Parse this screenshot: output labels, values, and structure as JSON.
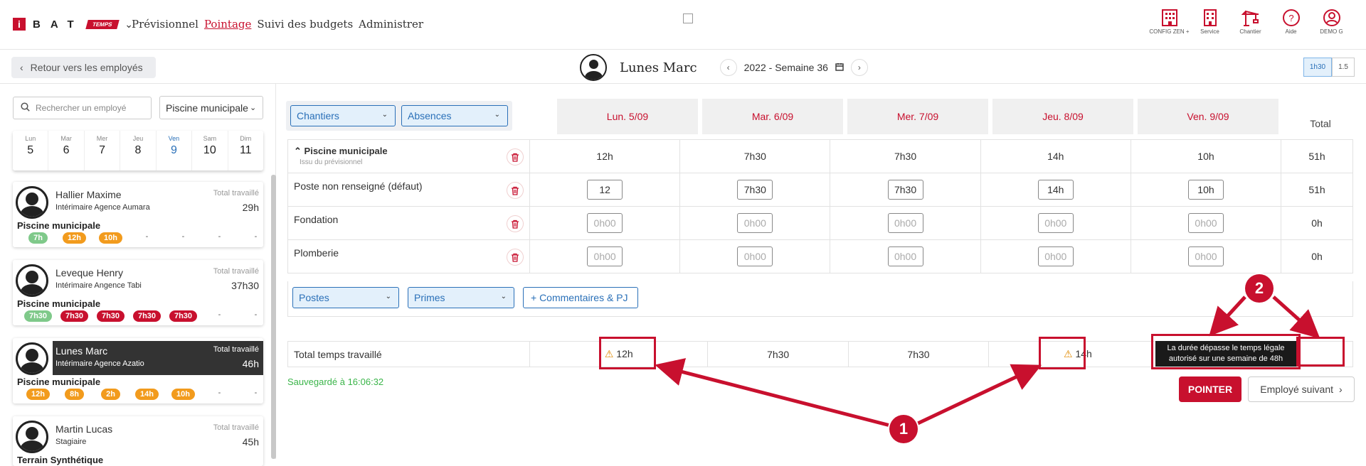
{
  "brand": {
    "letter": "i",
    "name": "BAT",
    "sub": "TEMPS"
  },
  "nav": [
    {
      "label": "Prévisionnel",
      "active": false
    },
    {
      "label": "Pointage",
      "active": true
    },
    {
      "label": "Suivi des budgets",
      "active": false
    },
    {
      "label": "Administrer",
      "active": false
    }
  ],
  "top_icons": [
    {
      "label": "CONFIG ZEN +",
      "icon": "building-icon"
    },
    {
      "label": "Service",
      "icon": "building-icon"
    },
    {
      "label": "Chantier",
      "icon": "crane-icon"
    },
    {
      "label": "Aide",
      "icon": "help-icon"
    },
    {
      "label": "DEMO G",
      "icon": "user-icon"
    }
  ],
  "back_label": "Retour vers les employés",
  "employee_title": "Lunes Marc",
  "week_label": "2022 - Semaine 36",
  "toggles": [
    "1h30",
    "1.5"
  ],
  "search_placeholder": "Rechercher un employé",
  "site_select": "Piscine municipale",
  "days": [
    {
      "n": "Lun",
      "d": "5"
    },
    {
      "n": "Mar",
      "d": "6"
    },
    {
      "n": "Mer",
      "d": "7"
    },
    {
      "n": "Jeu",
      "d": "8"
    },
    {
      "n": "Ven",
      "d": "9"
    },
    {
      "n": "Sam",
      "d": "10"
    },
    {
      "n": "Dim",
      "d": "11"
    }
  ],
  "employees": [
    {
      "name": "Hallier Maxime",
      "agency": "Intérimaire Agence Aumara",
      "total_label": "Total travaillé",
      "total": "29h",
      "site": "Piscine municipale",
      "pills": [
        {
          "v": "7h",
          "c": "g"
        },
        {
          "v": "12h",
          "c": "o"
        },
        {
          "v": "10h",
          "c": "o"
        },
        {
          "v": "-",
          "c": ""
        },
        {
          "v": "-",
          "c": ""
        },
        {
          "v": "-",
          "c": ""
        },
        {
          "v": "-",
          "c": ""
        }
      ]
    },
    {
      "name": "Leveque Henry",
      "agency": "Intérimaire Angence Tabi",
      "total_label": "Total travaillé",
      "total": "37h30",
      "site": "Piscine municipale",
      "pills": [
        {
          "v": "7h30",
          "c": "g"
        },
        {
          "v": "7h30",
          "c": "r"
        },
        {
          "v": "7h30",
          "c": "r"
        },
        {
          "v": "7h30",
          "c": "r"
        },
        {
          "v": "7h30",
          "c": "r"
        },
        {
          "v": "-",
          "c": ""
        },
        {
          "v": "-",
          "c": ""
        }
      ]
    },
    {
      "name": "Lunes Marc",
      "agency": "Intérimaire Agence Azatio",
      "total_label": "Total travaillé",
      "total": "46h",
      "site": "Piscine municipale",
      "pills": [
        {
          "v": "12h",
          "c": "o"
        },
        {
          "v": "8h",
          "c": "o"
        },
        {
          "v": "2h",
          "c": "o"
        },
        {
          "v": "14h",
          "c": "o"
        },
        {
          "v": "10h",
          "c": "o"
        },
        {
          "v": "-",
          "c": ""
        },
        {
          "v": "-",
          "c": ""
        }
      ]
    },
    {
      "name": "Martin Lucas",
      "agency": "Stagiaire",
      "total_label": "Total travaillé",
      "total": "45h",
      "site": "Terrain Synthétique",
      "pills": []
    }
  ],
  "filters": {
    "chantiers": "Chantiers",
    "absences": "Absences",
    "postes": "Postes",
    "primes": "Primes",
    "comments": "+ Commentaires & PJ"
  },
  "week_days": [
    "Lun. 5/09",
    "Mar. 6/09",
    "Mer. 7/09",
    "Jeu. 8/09",
    "Ven. 9/09"
  ],
  "total_header": "Total",
  "site_row": {
    "label": "Piscine municipale",
    "sub": "Issu du prévisionnel",
    "values": [
      "12h",
      "7h30",
      "7h30",
      "14h",
      "10h"
    ],
    "total": "51h"
  },
  "rows": [
    {
      "label": "Poste non renseigné (défaut)",
      "values": [
        "12",
        "7h30",
        "7h30",
        "14h",
        "10h"
      ],
      "placeholder": false,
      "total": "51h"
    },
    {
      "label": "Fondation",
      "values": [
        "0h00",
        "0h00",
        "0h00",
        "0h00",
        "0h00"
      ],
      "placeholder": true,
      "total": "0h"
    },
    {
      "label": "Plomberie",
      "values": [
        "0h00",
        "0h00",
        "0h00",
        "0h00",
        "0h00"
      ],
      "placeholder": true,
      "total": "0h"
    }
  ],
  "totals": {
    "label": "Total temps travaillé",
    "values": [
      "12h",
      "7h30",
      "7h30",
      "14h",
      ""
    ],
    "total": "51h"
  },
  "saved": "Sauvegardé à 16:06:32",
  "pointer": "POINTER",
  "next": "Employé suivant",
  "tooltip": "La durée dépasse le temps légale autorisé sur une semaine de 48h",
  "callouts": [
    "1",
    "2"
  ],
  "colors": {
    "brand": "#c8102e",
    "accent": "#2a70b8",
    "saved": "#3bb54a"
  }
}
